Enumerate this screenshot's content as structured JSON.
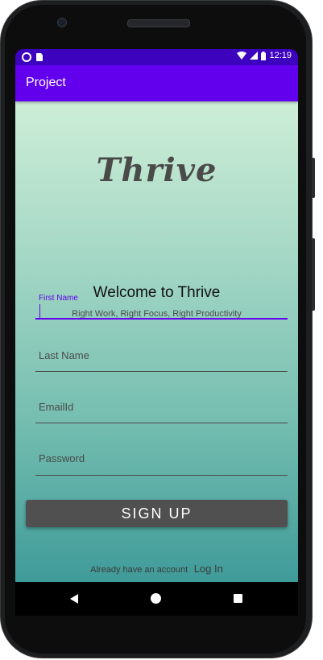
{
  "status_bar": {
    "time": "12:19",
    "icons": [
      "record-icon",
      "sd-card-icon",
      "wifi-icon",
      "signal-icon",
      "battery-icon"
    ]
  },
  "app_bar": {
    "title": "Project"
  },
  "logo": {
    "text": "Thrive"
  },
  "welcome": {
    "title": "Welcome to Thrive",
    "tagline": "Right Work, Right Focus, Right Productivity"
  },
  "form": {
    "first_name_label": "First Name",
    "last_name_placeholder": "Last Name",
    "email_placeholder": "EmailId",
    "password_placeholder": "Password",
    "signup_label": "SIGN UP"
  },
  "footer": {
    "prompt": "Already have an account",
    "login_label": "Log In"
  },
  "colors": {
    "status_bar": "#3c02bd",
    "app_bar": "#6200ee",
    "accent": "#6200ee",
    "button": "#505050"
  }
}
